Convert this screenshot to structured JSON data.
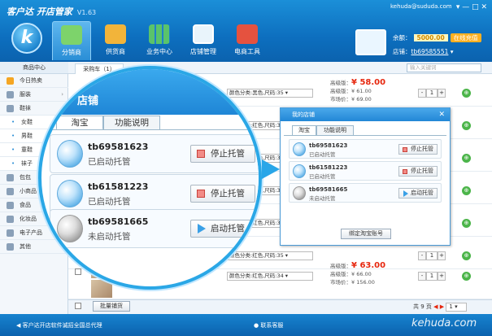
{
  "app": {
    "name": "客户达",
    "subtitle": "开店管家",
    "version": "V1.63",
    "account_email": "kehuda@sududa.com",
    "window_controls": "▾  —  □  ✕"
  },
  "nav_tabs": [
    {
      "label": "分销商"
    },
    {
      "label": "供货商"
    },
    {
      "label": "业务中心"
    },
    {
      "label": "店铺管理"
    },
    {
      "label": "电商工具"
    }
  ],
  "account": {
    "balance_label": "余额：",
    "balance_value": "5000.00",
    "recharge": "在线充值",
    "store_label": "店铺：",
    "store_name": "tb69585551"
  },
  "sidebar": {
    "header": "商品中心",
    "items": [
      {
        "label": "今日热卖",
        "color": "#f5a623"
      },
      {
        "label": "服装",
        "color": "#8aa0b8",
        "arrow": "›"
      },
      {
        "label": "鞋袜",
        "color": "#8aa0b8",
        "arrow": "›"
      },
      {
        "label": "女鞋",
        "sub": true
      },
      {
        "label": "男鞋",
        "sub": true
      },
      {
        "label": "童鞋",
        "sub": true
      },
      {
        "label": "袜子",
        "sub": true
      },
      {
        "label": "包包",
        "color": "#8aa0b8"
      },
      {
        "label": "小商品",
        "color": "#8aa0b8",
        "arrow": "›"
      },
      {
        "label": "食品",
        "color": "#8aa0b8"
      },
      {
        "label": "化妆品",
        "color": "#8aa0b8",
        "arrow": "›"
      },
      {
        "label": "电子产品",
        "color": "#8aa0b8",
        "arrow": "›"
      },
      {
        "label": "其他",
        "color": "#8aa0b8",
        "arrow": "›"
      }
    ]
  },
  "cart_tab": "采购车（1）",
  "search_placeholder": "输入关键词",
  "products": [
    {
      "variant": "颜色分类:黑色,尺码:35",
      "high": "高级版：",
      "high_price": "¥ 58.00",
      "senior": "高级版：¥ 61.00",
      "market": "市场价：¥ 69.00",
      "qty": "1"
    },
    {
      "variant": "颜色分类:红色,尺码:35",
      "qty": "1"
    },
    {
      "variant": "颜色分类:红色,尺码:35",
      "qty": "1"
    },
    {
      "variant": "颜色分类:红色,尺码:35",
      "qty": "1"
    },
    {
      "variant": "颜色分类:红色,尺码:35",
      "qty": "1"
    },
    {
      "variant": "颜色分类:红色,尺码:35",
      "qty": "1"
    },
    {
      "variant": "颜色分类:红色,尺码:34",
      "high": "高级版：",
      "high_price": "¥ 63.00",
      "senior": "高级版：¥ 66.00",
      "market": "市场价：¥ 156.00",
      "qty": "1"
    }
  ],
  "bottom": {
    "batch_button": "批量铺货",
    "pages": "共 9 页",
    "page": "1"
  },
  "status": {
    "left": "客户达开店软件诚招全国总代理",
    "middle": "联系客服",
    "watermark": "kehuda.com"
  },
  "lens": {
    "title": "店铺",
    "tabs": [
      "淘宝",
      "功能说明"
    ],
    "rows": [
      {
        "name": "tb69581623",
        "status": "已启动托管",
        "button": "停止托管",
        "action": "stop"
      },
      {
        "name": "tb61581223",
        "status": "已启动托管",
        "button": "停止托管",
        "action": "stop"
      },
      {
        "name": "tb69581665",
        "status": "未启动托管",
        "button": "启动托管",
        "action": "start"
      }
    ]
  },
  "popup": {
    "title": "我的店铺",
    "tabs": [
      "淘宝",
      "功能说明"
    ],
    "rows": [
      {
        "name": "tb69581623",
        "status": "已启动托管",
        "button": "停止托管"
      },
      {
        "name": "tb61581223",
        "status": "已启动托管",
        "button": "停止托管"
      },
      {
        "name": "tb69581665",
        "status": "未启动托管",
        "button": "启动托管"
      }
    ],
    "bind_button": "绑定淘宝账号",
    "close": "✕"
  }
}
